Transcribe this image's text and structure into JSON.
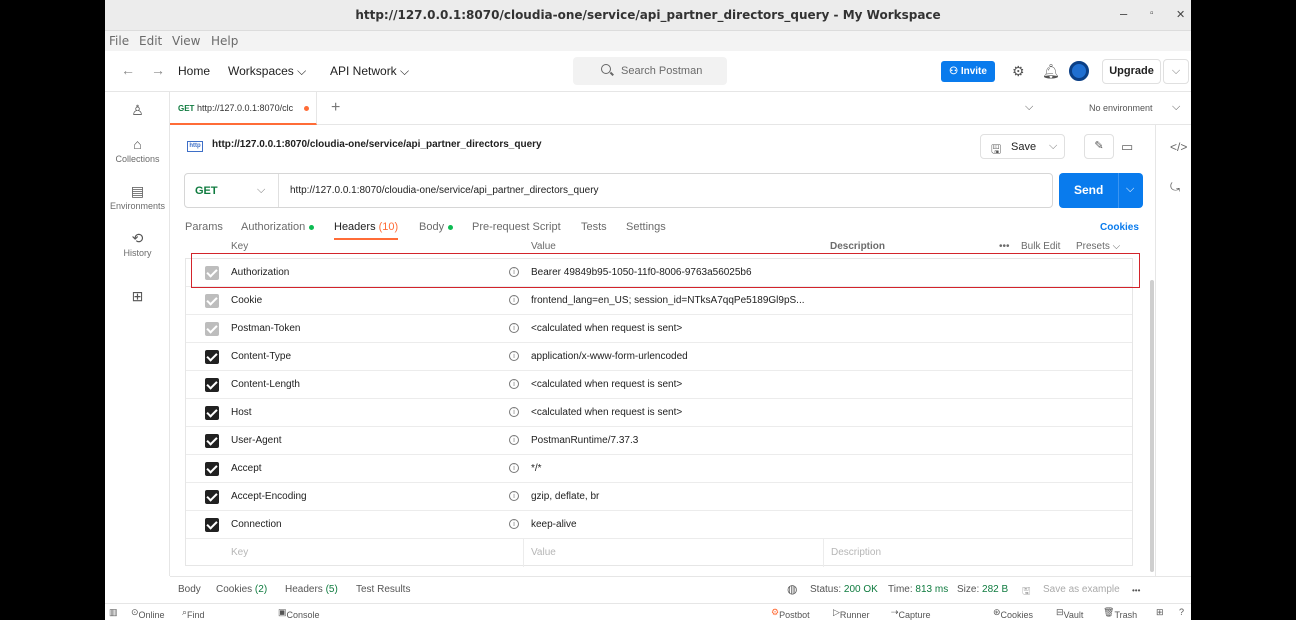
{
  "window": {
    "title": "http://127.0.0.1:8070/cloudia-one/service/api_partner_directors_query - My Workspace",
    "minimize": "–",
    "maximize": "▫",
    "close": "✕"
  },
  "menu": [
    "File",
    "Edit",
    "View",
    "Help"
  ],
  "nav": {
    "back": "←",
    "forward": "→",
    "home": "Home",
    "workspaces": "Workspaces ⌵",
    "api_network": "API Network ⌵",
    "search_placeholder": "Search Postman",
    "invite": "Invite",
    "upgrade": "Upgrade",
    "upgrade_chevron": "⌵"
  },
  "sidebar": [
    {
      "icon": "person-icon",
      "glyph": "♙",
      "label": ""
    },
    {
      "icon": "trash-can-collections-icon",
      "glyph": "🗑",
      "label": "Collections"
    },
    {
      "icon": "environments-icon",
      "glyph": "▤",
      "label": "Environments"
    },
    {
      "icon": "history-icon",
      "glyph": "⟲",
      "label": "History"
    },
    {
      "icon": "apps-icon",
      "glyph": "⊞",
      "label": ""
    }
  ],
  "tab": {
    "method": "GET",
    "url_short": "http://127.0.0.1:8070/clc",
    "plus": "+",
    "env_chevron": "⌵",
    "environment": "No environment"
  },
  "request": {
    "http_badge": "http",
    "name": "http://127.0.0.1:8070/cloudia-one/service/api_partner_directors_query",
    "save": "Save",
    "method": "GET",
    "url": "http://127.0.0.1:8070/cloudia-one/service/api_partner_directors_query",
    "send": "Send"
  },
  "section_tabs": {
    "params": "Params",
    "authorization": "Authorization",
    "headers": "Headers",
    "headers_count": "(10)",
    "body": "Body",
    "prerequest": "Pre-request Script",
    "tests": "Tests",
    "settings": "Settings",
    "cookies": "Cookies"
  },
  "table": {
    "col_key": "Key",
    "col_value": "Value",
    "col_desc": "Description",
    "more": "•••",
    "bulk_edit": "Bulk Edit",
    "presets": "Presets ⌵",
    "rows": [
      {
        "key": "Authorization",
        "value": "Bearer 49849b95-1050-11f0-8006-9763a56025b6",
        "state": "disabled"
      },
      {
        "key": "Cookie",
        "value": "frontend_lang=en_US; session_id=NTksA7qqPe5189Gl9pS...",
        "state": "disabled"
      },
      {
        "key": "Postman-Token",
        "value": "<calculated when request is sent>",
        "state": "disabled"
      },
      {
        "key": "Content-Type",
        "value": "application/x-www-form-urlencoded",
        "state": "on"
      },
      {
        "key": "Content-Length",
        "value": "<calculated when request is sent>",
        "state": "on"
      },
      {
        "key": "Host",
        "value": "<calculated when request is sent>",
        "state": "on"
      },
      {
        "key": "User-Agent",
        "value": "PostmanRuntime/7.37.3",
        "state": "on"
      },
      {
        "key": "Accept",
        "value": "*/*",
        "state": "on"
      },
      {
        "key": "Accept-Encoding",
        "value": "gzip, deflate, br",
        "state": "on"
      },
      {
        "key": "Connection",
        "value": "keep-alive",
        "state": "on"
      }
    ],
    "empty_key": "Key",
    "empty_value": "Value",
    "empty_desc": "Description"
  },
  "response": {
    "body": "Body",
    "cookies": "Cookies",
    "cookies_count": "(2)",
    "headers": "Headers",
    "headers_count": "(5)",
    "test_results": "Test Results",
    "status_label": "Status:",
    "status": "200 OK",
    "time_label": "Time:",
    "time": "813 ms",
    "size_label": "Size:",
    "size": "282 B",
    "save_example": "Save as example",
    "more": "•••"
  },
  "statusbar": {
    "online": "Online",
    "find_replace": "Find and replace",
    "console": "Console",
    "postbot": "Postbot",
    "runner": "Runner",
    "capture": "Capture requests",
    "cookies": "Cookies",
    "vault": "Vault",
    "trash": "Trash"
  },
  "colors": {
    "accent": "#ff6c37",
    "primary": "#097bed",
    "get": "#0f7b3f",
    "highlight": "#d3242b"
  }
}
